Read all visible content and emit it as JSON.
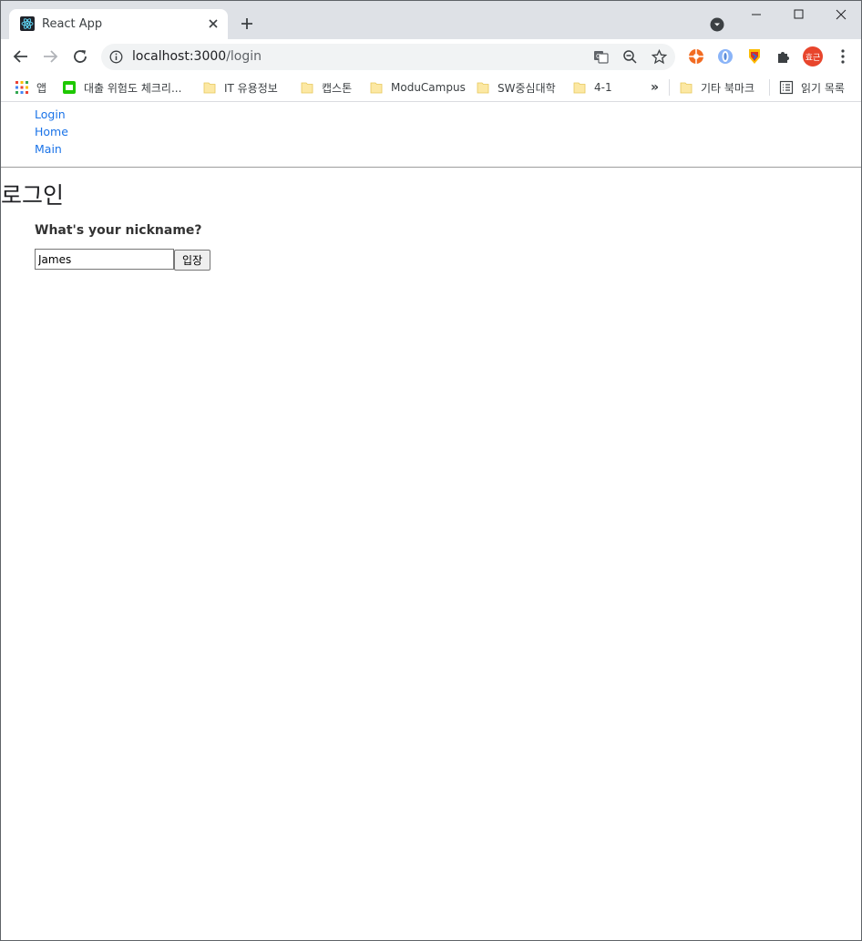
{
  "browser": {
    "tab": {
      "title": "React App"
    },
    "address": {
      "host": "localhost:3000",
      "path": "/login"
    },
    "avatar_label": "효근",
    "bookmarks": {
      "apps": "앱",
      "items": [
        "대출 위험도 체크리...",
        "IT  유용정보",
        "캡스톤",
        "ModuCampus",
        "SW중심대학",
        "4-1"
      ],
      "overflow": "»",
      "other": "기타 북마크",
      "reading_list": "읽기 목록"
    }
  },
  "page": {
    "nav": [
      "Login",
      "Home",
      "Main"
    ],
    "heading": "로그인",
    "question": "What's your nickname?",
    "nickname_value": "James",
    "enter_label": "입장"
  }
}
